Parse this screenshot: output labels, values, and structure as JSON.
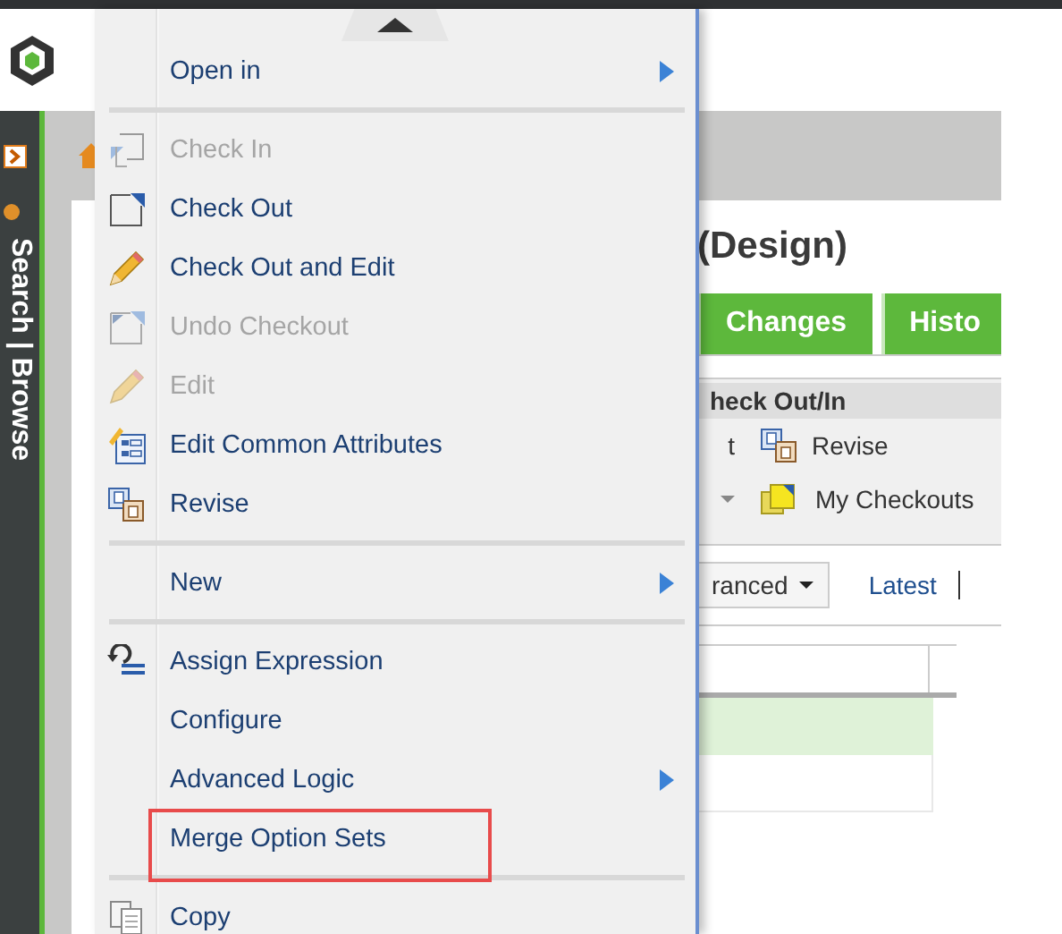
{
  "sidebar": {
    "label": "Search | Browse"
  },
  "page": {
    "title": "(Design)"
  },
  "tabs": [
    {
      "label": "Changes"
    },
    {
      "label": "Histo"
    }
  ],
  "toolbar": {
    "section_title": "heck Out/In",
    "rows": [
      [
        {
          "label": "t",
          "dropdown": false
        },
        {
          "label": "Revise",
          "dropdown": false
        }
      ],
      [
        {
          "dropdown": true
        },
        {
          "label": "My Checkouts",
          "dropdown": false
        }
      ]
    ]
  },
  "filter": {
    "dropdown": "ranced",
    "link": "Latest"
  },
  "table": {
    "rows": [
      {
        "selected": true
      },
      {
        "selected": false
      }
    ]
  },
  "context_menu": {
    "items": [
      {
        "kind": "item",
        "label": "Open in",
        "disabled": false,
        "submenu": true,
        "marked": false
      },
      {
        "kind": "separator"
      },
      {
        "kind": "item",
        "label": "Check In",
        "disabled": true,
        "submenu": false,
        "marked": false
      },
      {
        "kind": "item",
        "label": "Check Out",
        "disabled": false,
        "submenu": false,
        "marked": false
      },
      {
        "kind": "item",
        "label": "Check Out and Edit",
        "disabled": false,
        "submenu": false,
        "marked": false
      },
      {
        "kind": "item",
        "label": "Undo Checkout",
        "disabled": true,
        "submenu": false,
        "marked": false
      },
      {
        "kind": "item",
        "label": "Edit",
        "disabled": true,
        "submenu": false,
        "marked": false
      },
      {
        "kind": "item",
        "label": "Edit Common Attributes",
        "disabled": false,
        "submenu": false,
        "marked": false
      },
      {
        "kind": "item",
        "label": "Revise",
        "disabled": false,
        "submenu": false,
        "marked": false
      },
      {
        "kind": "separator"
      },
      {
        "kind": "item",
        "label": "New",
        "disabled": false,
        "submenu": true,
        "marked": false
      },
      {
        "kind": "separator"
      },
      {
        "kind": "item",
        "label": "Assign Expression",
        "disabled": false,
        "submenu": false,
        "marked": false
      },
      {
        "kind": "item",
        "label": "Configure",
        "disabled": false,
        "submenu": false,
        "marked": false
      },
      {
        "kind": "item",
        "label": "Advanced Logic",
        "disabled": false,
        "submenu": true,
        "marked": false
      },
      {
        "kind": "item",
        "label": "Merge Option Sets",
        "disabled": false,
        "submenu": false,
        "marked": true
      },
      {
        "kind": "separator"
      },
      {
        "kind": "item",
        "label": "Copy",
        "disabled": false,
        "submenu": false,
        "marked": false
      }
    ]
  }
}
